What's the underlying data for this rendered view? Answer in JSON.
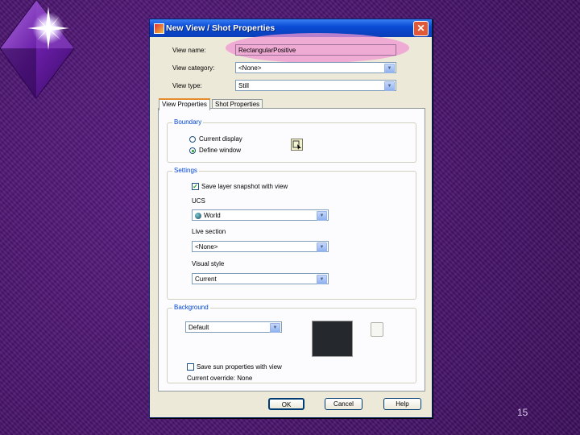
{
  "dialog": {
    "title": "New View / Shot Properties",
    "close_glyph": "✕",
    "view_name_label": "View name:",
    "view_name_value": "RectangularPositive",
    "view_category_label": "View category:",
    "view_category_value": "<None>",
    "view_type_label": "View type:",
    "view_type_value": "Still",
    "tabs": [
      {
        "label": "View Properties"
      },
      {
        "label": "Shot Properties"
      }
    ],
    "boundary": {
      "title": "Boundary",
      "option_current": "Current display",
      "option_define": "Define window"
    },
    "settings": {
      "title": "Settings",
      "save_layer_snapshot": "Save layer snapshot with view",
      "ucs_label": "UCS",
      "ucs_value": "World",
      "live_section_label": "Live section",
      "live_section_value": "<None>",
      "visual_style_label": "Visual style",
      "visual_style_value": "Current"
    },
    "background": {
      "title": "Background",
      "value": "Default",
      "save_sun_properties": "Save sun properties with view",
      "current_override": "Current override: None",
      "swatch_color": "#25292e"
    },
    "buttons": {
      "ok": "OK",
      "cancel": "Cancel",
      "help": "Help"
    }
  },
  "slide": {
    "page_number": "15"
  },
  "colors": {
    "background": "#4a1470",
    "title_bar": "#0b4bd6",
    "highlight": "#f096d2"
  }
}
